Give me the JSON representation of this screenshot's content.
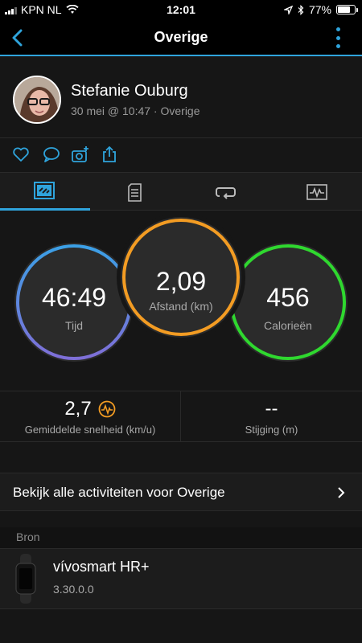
{
  "status_bar": {
    "carrier": "KPN NL",
    "time": "12:01",
    "battery_percent": "77%",
    "battery_level": 0.77,
    "icons": [
      "signal-icon",
      "wifi-icon",
      "location-icon",
      "bluetooth-icon",
      "battery-icon"
    ]
  },
  "nav": {
    "title": "Overige",
    "back_icon": "chevron-left-icon",
    "more_icon": "more-vertical-icon"
  },
  "activity": {
    "user_name": "Stefanie Ouburg",
    "meta": "30 mei @ 10:47 · Overige"
  },
  "actions": [
    "heart-icon",
    "comment-icon",
    "add-photo-icon",
    "share-icon"
  ],
  "tabs": [
    {
      "name": "overview",
      "icon": "overview-icon",
      "active": true
    },
    {
      "name": "details",
      "icon": "document-icon",
      "active": false
    },
    {
      "name": "laps",
      "icon": "repeat-icon",
      "active": false
    },
    {
      "name": "charts",
      "icon": "chart-icon",
      "active": false
    }
  ],
  "rings": {
    "time": {
      "value": "46:49",
      "label": "Tijd"
    },
    "distance": {
      "value": "2,09",
      "label": "Afstand (km)"
    },
    "calories": {
      "value": "456",
      "label": "Calorieën"
    }
  },
  "stats": {
    "avg_speed": {
      "value": "2,7",
      "label": "Gemiddelde snelheid (km/u)",
      "icon": "activity-badge-icon"
    },
    "elevation": {
      "value": "--",
      "label": "Stijging (m)"
    }
  },
  "view_all": {
    "label": "Bekijk alle activiteiten voor Overige"
  },
  "source": {
    "header": "Bron",
    "device_name": "vívosmart HR+",
    "device_version": "3.30.0.0"
  },
  "colors": {
    "accent": "#2fa4dc",
    "orange": "#f39c23",
    "green": "#2fd82f",
    "blue": "#3ba0e6",
    "purple": "#7f6fd8"
  }
}
